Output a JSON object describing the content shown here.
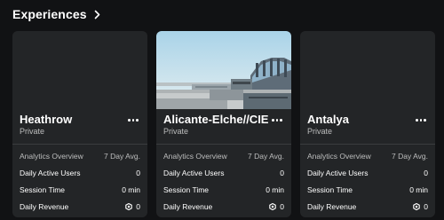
{
  "header": {
    "title": "Experiences"
  },
  "cards": [
    {
      "name": "Heathrow",
      "privacy": "Private",
      "analytics_label": "Analytics Overview",
      "period": "7 Day Avg.",
      "stats": [
        {
          "label": "Daily Active Users",
          "value": "0"
        },
        {
          "label": "Session Time",
          "value": "0 min"
        },
        {
          "label": "Daily Revenue",
          "value": "0"
        }
      ]
    },
    {
      "name": "Alicante-Elche//CIEL",
      "privacy": "Private",
      "analytics_label": "Analytics Overview",
      "period": "7 Day Avg.",
      "stats": [
        {
          "label": "Daily Active Users",
          "value": "0"
        },
        {
          "label": "Session Time",
          "value": "0 min"
        },
        {
          "label": "Daily Revenue",
          "value": "0"
        }
      ]
    },
    {
      "name": "Antalya",
      "privacy": "Private",
      "analytics_label": "Analytics Overview",
      "period": "7 Day Avg.",
      "stats": [
        {
          "label": "Daily Active Users",
          "value": "0"
        },
        {
          "label": "Session Time",
          "value": "0 min"
        },
        {
          "label": "Daily Revenue",
          "value": "0"
        }
      ]
    }
  ],
  "icons": {
    "header_chevron": "chevron-right-icon",
    "card_menu": "more-options-icon",
    "currency": "robux-icon"
  },
  "colors": {
    "background": "#111214",
    "card": "#232527",
    "secondary_text": "#bdbebe"
  }
}
